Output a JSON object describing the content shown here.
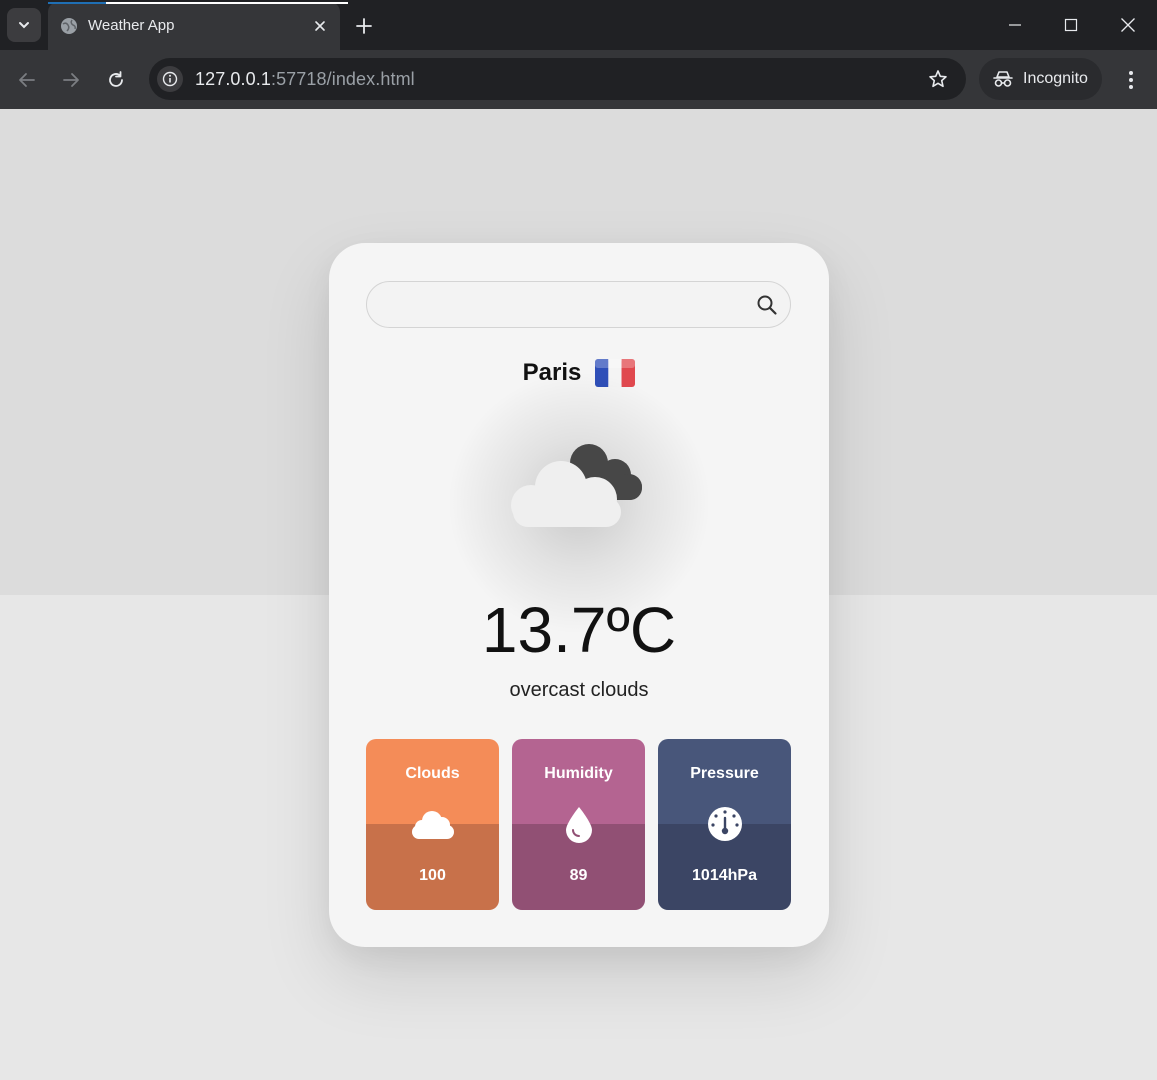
{
  "browser": {
    "tab_title": "Weather App",
    "url_host": "127.0.0.1",
    "url_rest": ":57718/index.html",
    "incognito_label": "Incognito"
  },
  "search": {
    "value": "",
    "placeholder": ""
  },
  "location": {
    "city": "Paris",
    "flag": "FR"
  },
  "weather": {
    "icon": "broken-clouds-icon",
    "temperature": "13.7ºC",
    "description": "overcast clouds"
  },
  "stats": [
    {
      "label": "Clouds",
      "value": "100",
      "icon": "cloud-icon",
      "color_top": "#f48c58",
      "color_bottom": "#c8714a"
    },
    {
      "label": "Humidity",
      "value": "89",
      "icon": "droplet-icon",
      "color_top": "#b46491",
      "color_bottom": "#915074"
    },
    {
      "label": "Pressure",
      "value": "1014hPa",
      "icon": "gauge-icon",
      "color_top": "#48567a",
      "color_bottom": "#3b4564"
    }
  ],
  "colors": {
    "page_bg_top": "#dcdcdc",
    "page_bg_bottom": "#e7e7e7",
    "card_bg": "#f5f5f5"
  }
}
